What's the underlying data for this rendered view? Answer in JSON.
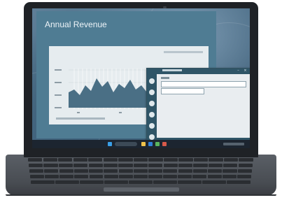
{
  "screen": {
    "app_title": "Annual Revenue"
  },
  "colors": {
    "app_background": "#4f7c93",
    "chart_fill": "#4a6f85",
    "dialog_titlebar": "#2f5567",
    "laptop_body": "#484c52"
  }
}
